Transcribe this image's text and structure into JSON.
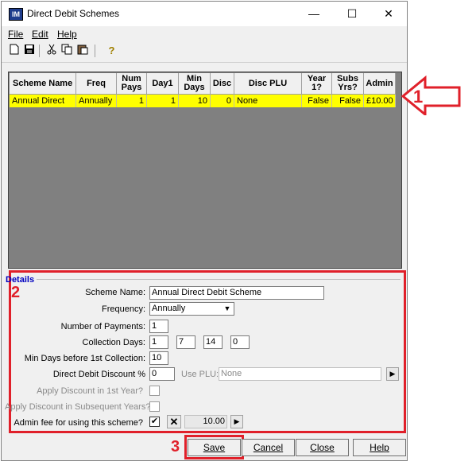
{
  "window": {
    "title": "Direct Debit Schemes",
    "app_icon_text": "IM",
    "controls": {
      "minimize": "—",
      "maximize": "☐",
      "close": "✕"
    }
  },
  "menu": {
    "file": "File",
    "edit": "Edit",
    "help": "Help"
  },
  "toolbar": {
    "icons": [
      "new-icon",
      "save-icon",
      "cut-icon",
      "copy-icon",
      "paste-icon",
      "help-icon"
    ]
  },
  "grid": {
    "columns": [
      "Scheme Name",
      "Freq",
      "Num Pays",
      "Day1",
      "Min Days",
      "Disc",
      "Disc PLU",
      "Year 1?",
      "Subs Yrs?",
      "Admin"
    ],
    "rows": [
      [
        "Annual Direct",
        "Annually",
        "1",
        "1",
        "10",
        "0",
        "None",
        "False",
        "False",
        "£10.00"
      ]
    ],
    "selected_row_color": "#ffff00"
  },
  "callouts": {
    "one": "1",
    "two": "2",
    "three": "3",
    "color": "#e0202a"
  },
  "details": {
    "title": "Details",
    "scheme_name_label": "Scheme Name:",
    "scheme_name_value": "Annual Direct Debit Scheme",
    "frequency_label": "Frequency:",
    "frequency_value": "Annually",
    "num_payments_label": "Number of Payments:",
    "num_payments_value": "1",
    "collection_days_label": "Collection Days:",
    "collection_days": [
      "1",
      "7",
      "14",
      "0"
    ],
    "min_days_label": "Min Days before 1st Collection:",
    "min_days_value": "10",
    "discount_label": "Direct Debit Discount %",
    "discount_value": "0",
    "use_plu_label": "Use PLU:",
    "use_plu_value": "None",
    "apply_first_year_label": "Apply Discount in 1st Year?",
    "apply_subsequent_label": "Apply Discount in Subsequent Years?",
    "admin_fee_label": "Admin fee for using this scheme?",
    "admin_fee_value": "10.00",
    "admin_fee_checked": true
  },
  "buttons": {
    "save": "Save",
    "cancel": "Cancel",
    "close": "Close",
    "help": "Help"
  }
}
